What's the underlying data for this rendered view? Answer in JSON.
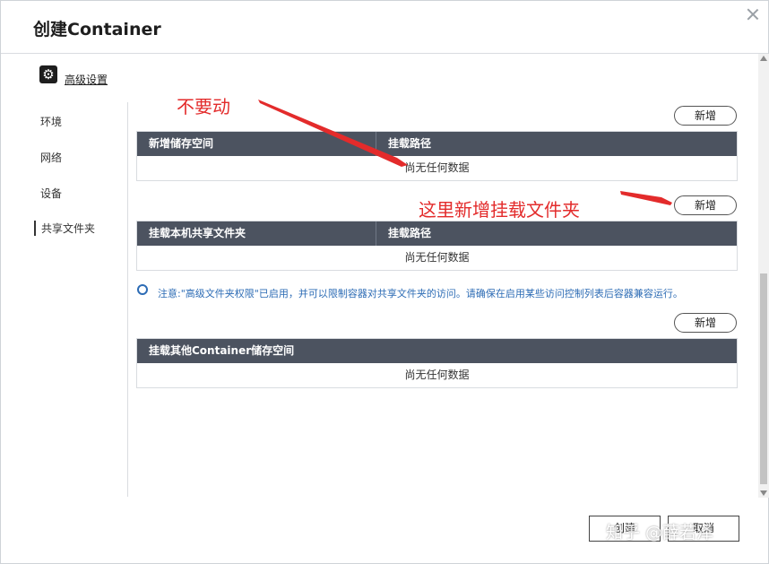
{
  "dialog": {
    "title": "创建Container"
  },
  "advanced": {
    "label": "高级设置",
    "icon": "gear-icon"
  },
  "sidebar": {
    "items": [
      {
        "label": "环境"
      },
      {
        "label": "网络"
      },
      {
        "label": "设备"
      },
      {
        "label": "共享文件夹",
        "active": true
      }
    ]
  },
  "sections": {
    "storage": {
      "add_label": "新增",
      "col1": "新增储存空间",
      "col2": "挂载路径",
      "empty": "尚无任何数据"
    },
    "shared_folder": {
      "add_label": "新增",
      "col1": "挂载本机共享文件夹",
      "col2": "挂载路径",
      "empty": "尚无任何数据"
    },
    "container_storage": {
      "add_label": "新增",
      "col1": "挂载其他Container储存空间",
      "empty": "尚无任何数据"
    }
  },
  "notice": {
    "text": "注意:\"高级文件夹权限\"已启用，并可以限制容器对共享文件夹的访问。请确保在启用某些访问控制列表后容器兼容运行。"
  },
  "annotations": {
    "dont_touch": "不要动",
    "add_here": "这里新增挂载文件夹"
  },
  "footer": {
    "create_label": "创建",
    "cancel_label": "取消"
  },
  "watermark": {
    "text": "知乎 @薛若泽"
  },
  "colors": {
    "table_header": "#4c5360",
    "annotation": "#e32b2b",
    "notice": "#2d6cb5"
  }
}
